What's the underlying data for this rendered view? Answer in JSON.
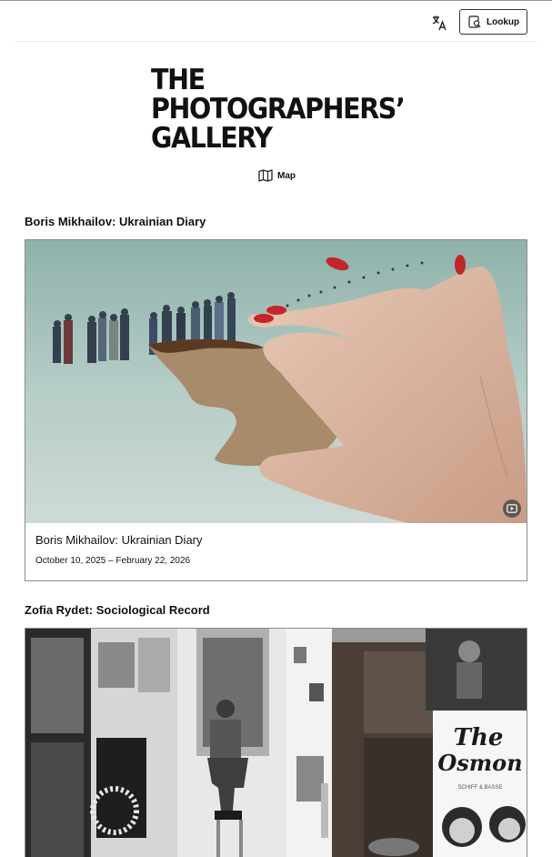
{
  "toolbar": {
    "translate_icon": "translate-icon",
    "lookup_label": "Lookup",
    "lookup_icon": "lookup-icon"
  },
  "logo": {
    "line1": "THE",
    "line2": "PHOTOGRAPHERS’",
    "line3": "GALLERY"
  },
  "map": {
    "label": "Map",
    "icon": "map-icon"
  },
  "exhibitions": [
    {
      "heading": "Boris Mikhailov: Ukrainian Diary",
      "title": "Boris Mikhailov: Ukrainian Diary",
      "dates": "October 10, 2025 – February 22, 2026"
    },
    {
      "heading": "Zofia Rydet: Sociological Record",
      "poster_text": "The Osmonds",
      "poster_small": "SCHIFF & BASSE"
    }
  ],
  "colors": {
    "text": "#111111",
    "border": "#8a8a8a",
    "sky": "#a9c3bd",
    "hand": "#ddb6a0",
    "nails": "#c2262b"
  }
}
